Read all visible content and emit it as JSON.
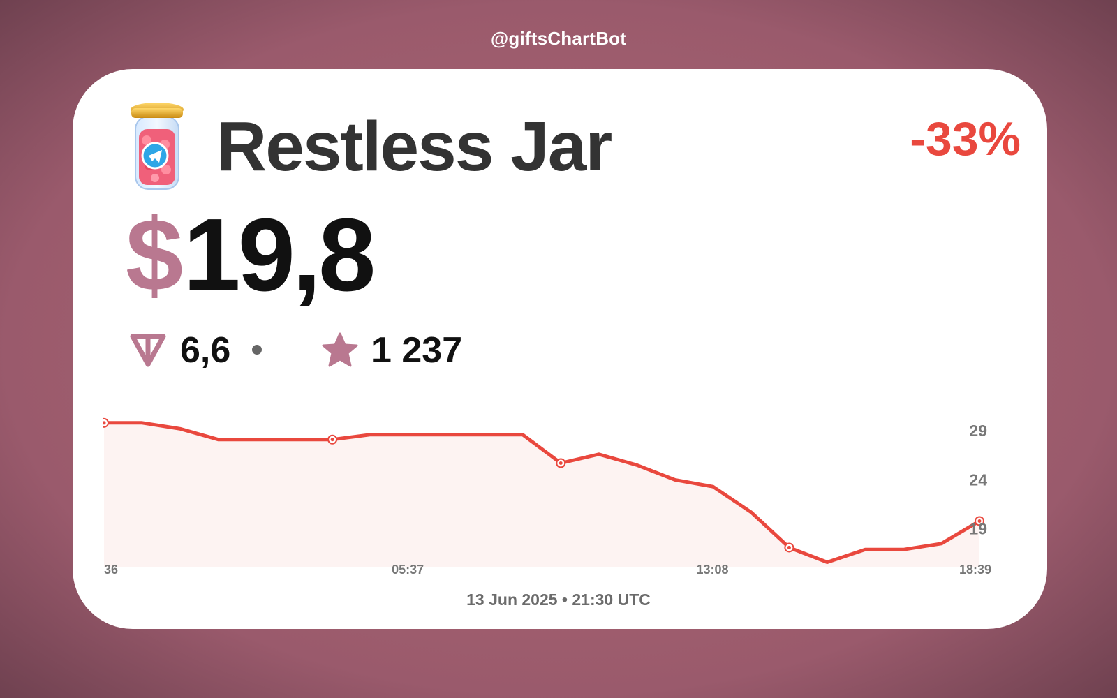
{
  "handle": "@giftsChartBot",
  "gift": {
    "name": "Restless Jar",
    "icon": "jar-icon",
    "change": "-33%",
    "change_color": "#e9483e"
  },
  "price": {
    "currency_symbol": "$",
    "value": "19,8",
    "ton_value": "6,6",
    "ton_icon": "ton-icon",
    "stars_value": "1 237",
    "stars_icon": "star-icon"
  },
  "colors": {
    "accent": "#b97890",
    "line": "#e9483e",
    "area": "#fdf3f2"
  },
  "chart_data": {
    "type": "area",
    "x_tick_labels": [
      "36",
      "05:37",
      "13:08",
      "18:39"
    ],
    "y_tick_labels": [
      "29",
      "24",
      "19"
    ],
    "y_ticks": [
      29,
      24,
      19
    ],
    "ylim": [
      14.5,
      30.5
    ],
    "values": [
      29.8,
      29.8,
      29.2,
      28.1,
      28.1,
      28.1,
      28.1,
      28.6,
      28.6,
      28.6,
      28.6,
      28.6,
      25.7,
      26.6,
      25.5,
      24.0,
      23.3,
      20.7,
      17.1,
      15.6,
      16.9,
      16.9,
      17.5,
      19.8
    ],
    "markers": [
      0,
      6,
      12,
      18,
      23
    ],
    "grid": false,
    "legend": "none"
  },
  "footer": {
    "date": "13 Jun 2025 • 21:30 UTC"
  }
}
